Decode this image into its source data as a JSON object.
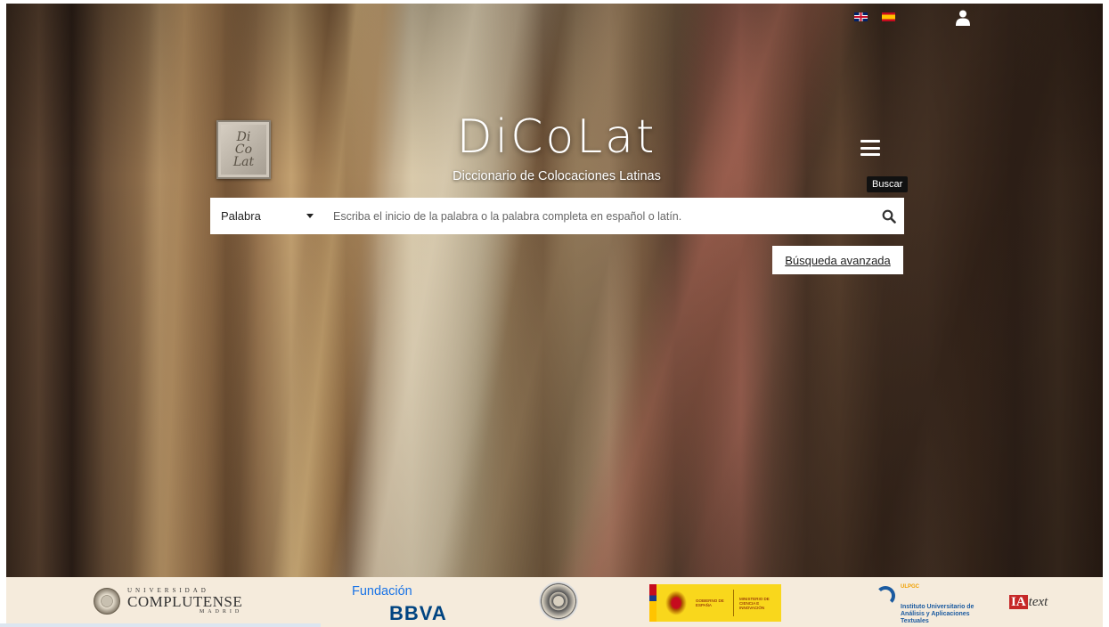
{
  "header": {
    "languages": [
      {
        "code": "en",
        "icon": "uk-flag-icon"
      },
      {
        "code": "es",
        "icon": "spain-flag-icon"
      }
    ],
    "user_icon": "user-icon"
  },
  "brand": {
    "logo_lines": [
      "Di",
      "Co",
      "Lat"
    ],
    "title": "DiCoLat",
    "subtitle": "Diccionario de Colocaciones Latinas"
  },
  "menu": {
    "icon": "hamburger-menu-icon",
    "tooltip": "Buscar"
  },
  "search": {
    "type_selected": "Palabra",
    "placeholder": "Escriba el inicio de la palabra o la palabra completa en español o latín.",
    "value": "",
    "button_icon": "search-icon",
    "advanced_label": "Búsqueda avanzada"
  },
  "footer": {
    "sponsors": {
      "ucm": {
        "top": "UNIVERSIDAD",
        "name": "COMPLUTENSE",
        "bottom": "MADRID"
      },
      "bbva": {
        "top": "Fundación",
        "name": "BBVA"
      },
      "gobierno": {
        "left": "GOBIERNO DE ESPAÑA",
        "right": "MINISTERIO DE CIENCIA E INNOVACIÓN"
      },
      "ulpgc": {
        "name": "ULPGC",
        "line1": "Instituto Universitario de",
        "line2": "Análisis y Aplicaciones",
        "line3": "Textuales"
      },
      "iatext": {
        "mark": "IA",
        "text": "text"
      }
    }
  },
  "colors": {
    "footer_bg": "#f5ebdc",
    "bbva_blue": "#004481",
    "fundacion_blue": "#1973e6",
    "gov_yellow": "#f9d71c"
  }
}
